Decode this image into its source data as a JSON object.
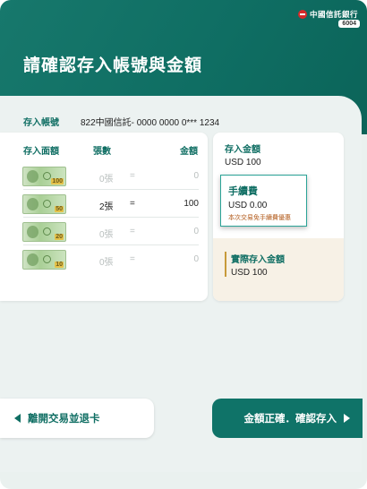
{
  "brand": {
    "name": "中國信託銀行",
    "atm_id": "6004",
    "logo_icon": "ctbc-logo-icon"
  },
  "page": {
    "title": "請確認存入帳號與金額"
  },
  "account": {
    "label": "存入帳號",
    "value": "822中國信託- 0000 0000 0*** 1234"
  },
  "notes_table": {
    "headers": {
      "denomination": "存入面額",
      "count": "張數",
      "amount": "金額"
    },
    "rows": [
      {
        "denomination": "100",
        "count": "0張",
        "equals": "=",
        "amount": "0",
        "active": false
      },
      {
        "denomination": "50",
        "count": "2張",
        "equals": "=",
        "amount": "100",
        "active": true
      },
      {
        "denomination": "20",
        "count": "0張",
        "equals": "=",
        "amount": "0",
        "active": false
      },
      {
        "denomination": "10",
        "count": "0張",
        "equals": "=",
        "amount": "0",
        "active": false
      }
    ]
  },
  "summary": {
    "deposit_label": "存入金額",
    "deposit_value": "USD 100",
    "fee_label": "手續費",
    "fee_value": "USD 0.00",
    "fee_note": "本次交易免手續費優惠",
    "actual_label": "實際存入金額",
    "actual_value": "USD 100"
  },
  "actions": {
    "exit_label": "離開交易並退卡",
    "confirm_label": "金額正確．確認存入"
  },
  "colors": {
    "brand_teal": "#0f6e63",
    "accent_gold": "#c79a3a",
    "logo_red": "#d62a2a"
  }
}
